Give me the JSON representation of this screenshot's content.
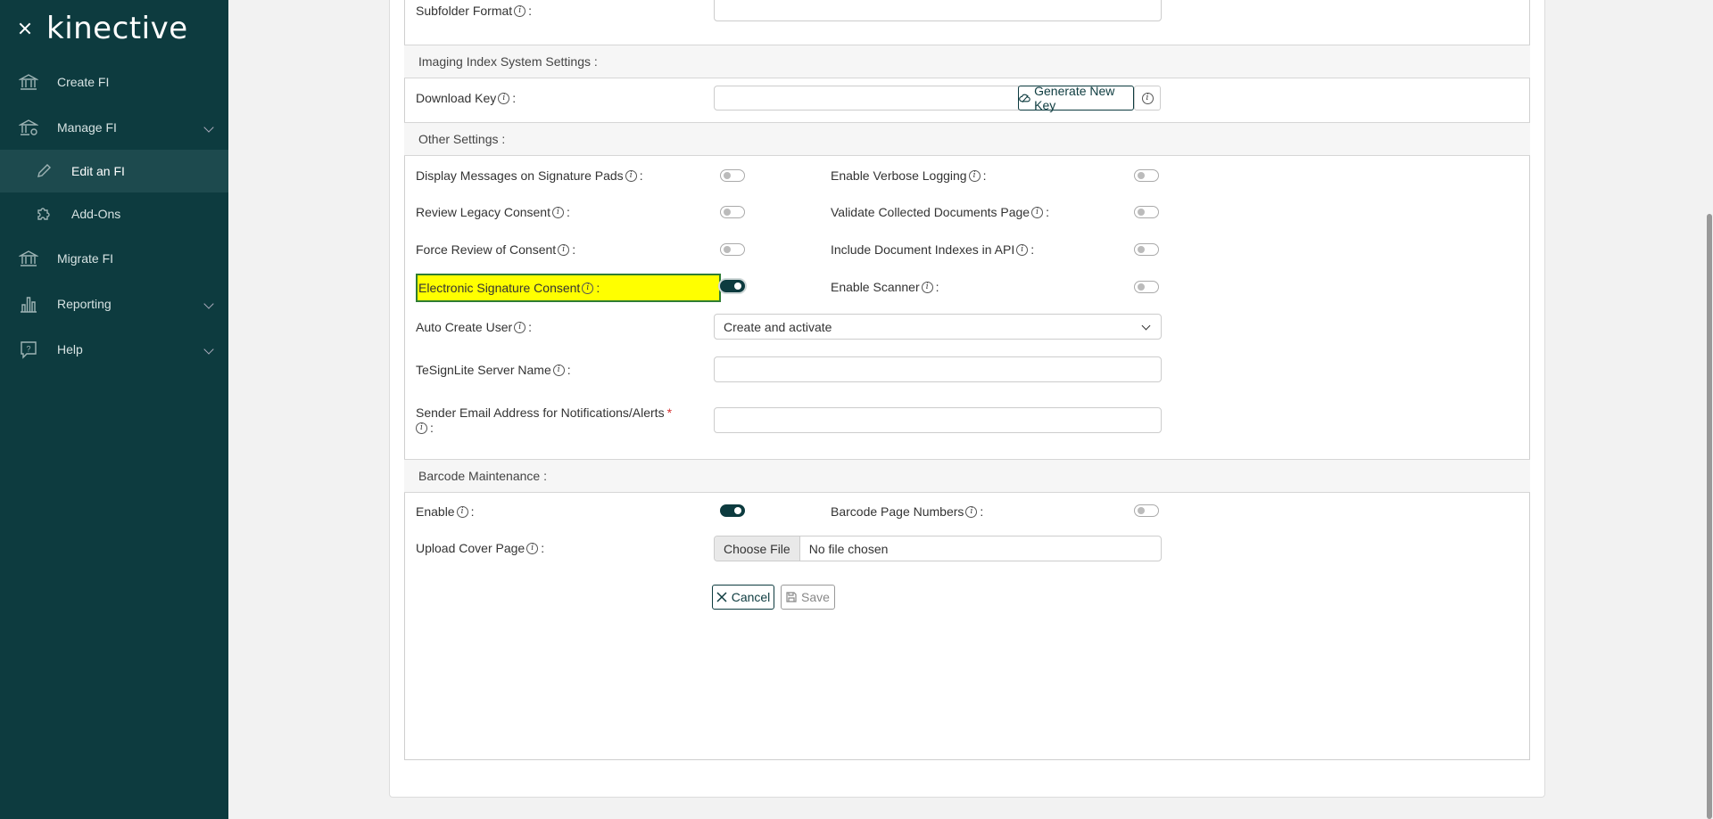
{
  "sidebar": {
    "logo": "kinective",
    "items": [
      {
        "label": "Create FI",
        "icon": "bank-icon"
      },
      {
        "label": "Manage FI",
        "icon": "bank-gear-icon"
      },
      {
        "label": "Edit an FI",
        "icon": "pencil-icon"
      },
      {
        "label": "Add-Ons",
        "icon": "puzzle-icon"
      },
      {
        "label": "Migrate FI",
        "icon": "bank-arrow-icon"
      },
      {
        "label": "Reporting",
        "icon": "bar-chart-icon"
      },
      {
        "label": "Help",
        "icon": "help-bubble-icon"
      }
    ]
  },
  "form": {
    "subfolder_format_label": "Subfolder Format",
    "imaging_section": "Imaging Index System Settings :",
    "download_key_label": "Download Key",
    "generate_key_button": "Generate New Key",
    "other_section": "Other Settings :",
    "display_messages_label": "Display Messages on Signature Pads",
    "verbose_logging_label": "Enable Verbose Logging",
    "review_legacy_label": "Review Legacy Consent",
    "validate_docs_label": "Validate Collected Documents Page",
    "force_review_label": "Force Review of Consent",
    "include_indexes_label": "Include Document Indexes in API",
    "esign_consent_label": "Electronic Signature Consent",
    "enable_scanner_label": "Enable Scanner",
    "auto_create_user_label": "Auto Create User",
    "auto_create_user_value": "Create and activate",
    "tesign_server_label": "TeSignLite Server Name",
    "sender_email_label": "Sender Email Address for Notifications/Alerts",
    "required_mark": "*",
    "barcode_section": "Barcode Maintenance :",
    "barcode_enable_label": "Enable",
    "barcode_page_numbers_label": "Barcode Page Numbers",
    "upload_cover_label": "Upload Cover Page",
    "choose_file_button": "Choose File",
    "no_file_text": "No file chosen",
    "cancel_button": "Cancel",
    "save_button": "Save",
    "colon": ":",
    "info_glyph": "i"
  },
  "toggles": {
    "display_messages": false,
    "verbose_logging": false,
    "review_legacy": false,
    "validate_docs": false,
    "force_review": false,
    "include_indexes": false,
    "esign_consent": true,
    "enable_scanner": false,
    "barcode_enable": true,
    "barcode_page_numbers": false
  },
  "colors": {
    "sidebar_bg": "#0d3b3f",
    "highlight": "#ffff00",
    "accent": "#0d3b3f",
    "required": "#d32f2f"
  }
}
